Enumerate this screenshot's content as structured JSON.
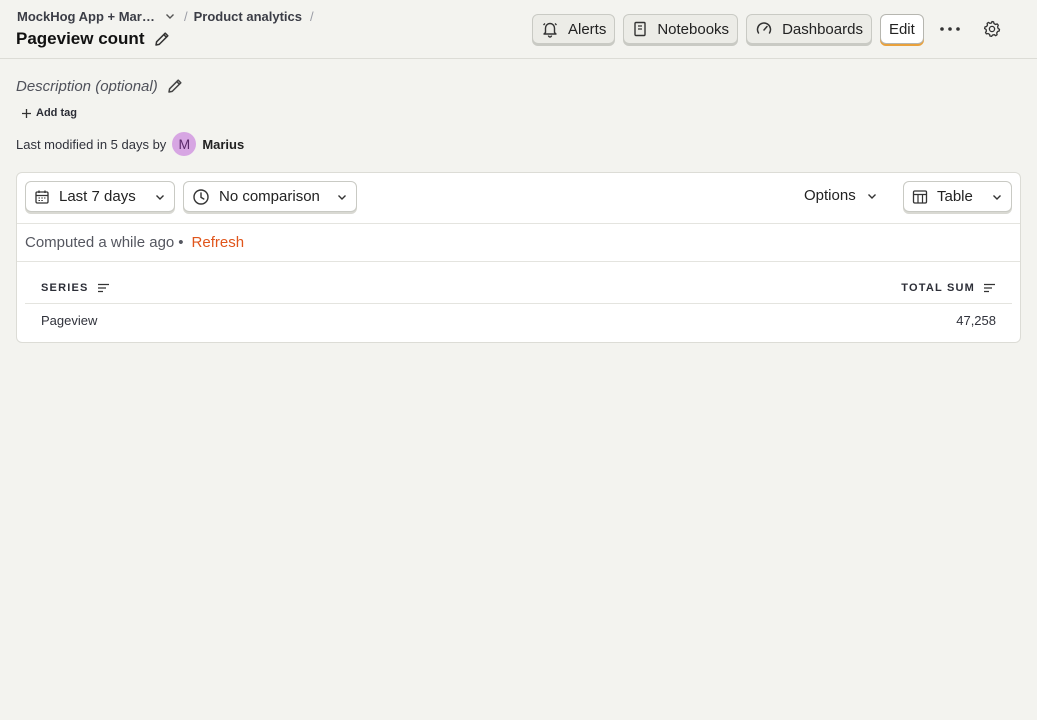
{
  "breadcrumb": {
    "project": "MockHog App + Marketing",
    "section": "Product analytics",
    "separator": "/"
  },
  "page": {
    "title": "Pageview count"
  },
  "toolbar": {
    "alerts_label": "Alerts",
    "notebooks_label": "Notebooks",
    "dashboards_label": "Dashboards",
    "edit_label": "Edit"
  },
  "meta": {
    "description_placeholder": "Description (optional)",
    "add_tag_label": "Add tag",
    "modified_text": "Last modified in 5 days by",
    "author_initial": "M",
    "author_name": "Marius"
  },
  "insight": {
    "date_range": "Last 7 days",
    "comparison": "No comparison",
    "options_label": "Options",
    "display_type": "Table",
    "computed_text": "Computed a while ago",
    "bullet": "•",
    "refresh_label": "Refresh"
  },
  "table": {
    "columns": [
      "Series",
      "Total sum"
    ],
    "rows": [
      {
        "series": "Pageview",
        "total": "47,258"
      }
    ]
  },
  "colors": {
    "accent": "#e0551b",
    "edit_highlight": "#e9a13c",
    "avatar_bg": "#d7a6e3"
  }
}
